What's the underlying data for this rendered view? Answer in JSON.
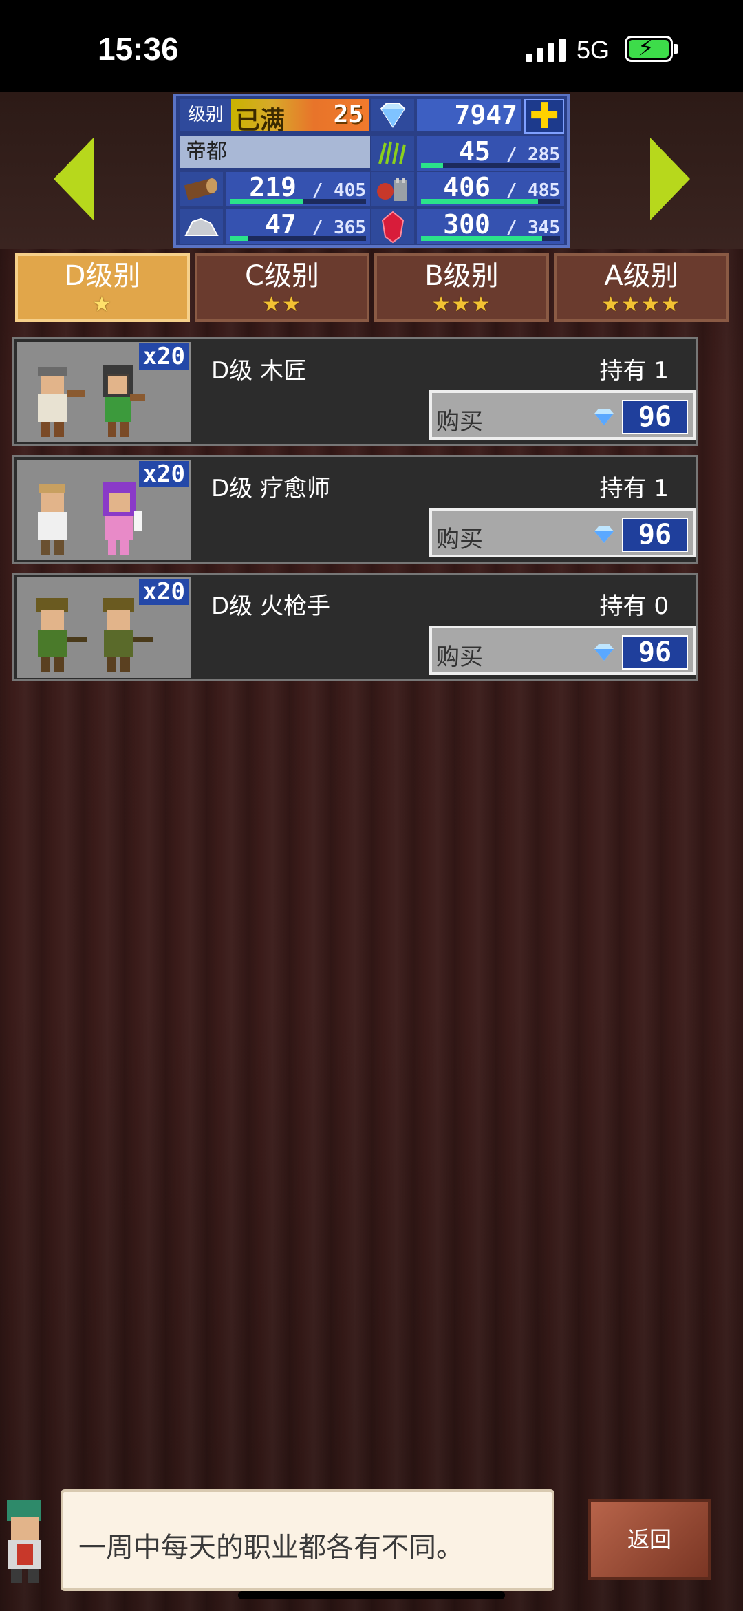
{
  "status_bar": {
    "time": "15:36",
    "network": "5G"
  },
  "header": {
    "level_label": "级别",
    "level_status": "已满",
    "level_value": "25",
    "diamonds": "7947",
    "city_name": "帝都",
    "resources": [
      {
        "icon": "grass-icon",
        "current": "45",
        "max": "285",
        "fraction": 0.16
      },
      {
        "icon": "wood-icon",
        "current": "219",
        "max": "405",
        "fraction": 0.54
      },
      {
        "icon": "food-icon",
        "current": "406",
        "max": "485",
        "fraction": 0.84
      },
      {
        "icon": "ore-icon",
        "current": "47",
        "max": "365",
        "fraction": 0.13
      },
      {
        "icon": "ruby-icon",
        "current": "300",
        "max": "345",
        "fraction": 0.87
      }
    ]
  },
  "tabs": [
    {
      "label": "D级别",
      "stars": "★"
    },
    {
      "label": "C级别",
      "stars": "★★"
    },
    {
      "label": "B级别",
      "stars": "★★★"
    },
    {
      "label": "A级别",
      "stars": "★★★★"
    }
  ],
  "jobs": [
    {
      "name": "D级 木匠",
      "owned": "持有 1",
      "qty": "x20",
      "buy_label": "购买",
      "price": "96"
    },
    {
      "name": "D级 疗愈师",
      "owned": "持有 1",
      "qty": "x20",
      "buy_label": "购买",
      "price": "96"
    },
    {
      "name": "D级 火枪手",
      "owned": "持有 0",
      "qty": "x20",
      "buy_label": "购买",
      "price": "96"
    }
  ],
  "tip": "一周中每天的职业都各有不同。",
  "back_label": "返回",
  "colors": {
    "active_tab": "#e1a64a",
    "nav_arrow": "#b7d81c",
    "panel": "#2a3f86",
    "bar_fill": "#2be38a"
  }
}
